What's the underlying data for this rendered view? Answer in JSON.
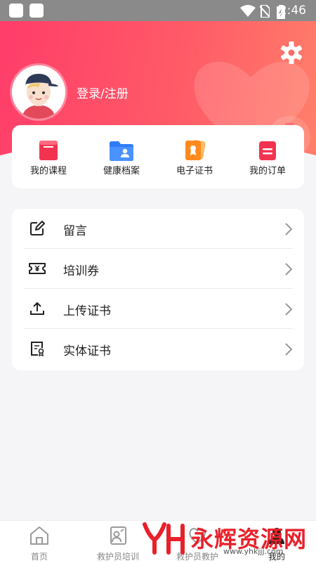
{
  "status_bar": {
    "time": "2:46",
    "icons": [
      "wifi-icon",
      "no-sim-icon",
      "battery-charging-icon"
    ]
  },
  "profile": {
    "login_label": "登录/注册",
    "avatar": "avatar"
  },
  "quick_actions": [
    {
      "label": "我的课程",
      "icon": "course-book-icon",
      "color": "#f2334f"
    },
    {
      "label": "健康档案",
      "icon": "health-folder-icon",
      "color": "#2f7cf6"
    },
    {
      "label": "电子证书",
      "icon": "certificate-icon",
      "color": "#ff8a1e"
    },
    {
      "label": "我的订单",
      "icon": "order-list-icon",
      "color": "#f2334f"
    }
  ],
  "menu": [
    {
      "label": "留言",
      "icon": "edit-note-icon"
    },
    {
      "label": "培训券",
      "icon": "ticket-icon"
    },
    {
      "label": "上传证书",
      "icon": "upload-icon"
    },
    {
      "label": "实体证书",
      "icon": "document-certificate-icon"
    }
  ],
  "tabs": [
    {
      "label": "首页",
      "icon": "home-icon"
    },
    {
      "label": "救护员培训",
      "icon": "trainer-icon"
    },
    {
      "label": "救护员教护",
      "icon": "rescue-icon"
    },
    {
      "label": "我的",
      "icon": "profile-icon"
    }
  ],
  "watermark": {
    "text": "永辉资源网",
    "url": "www.yhkjjj.com"
  },
  "colors": {
    "accent": "#ff3d69",
    "accent_end": "#ff7f6a",
    "page_bg": "#f5f5f7"
  }
}
